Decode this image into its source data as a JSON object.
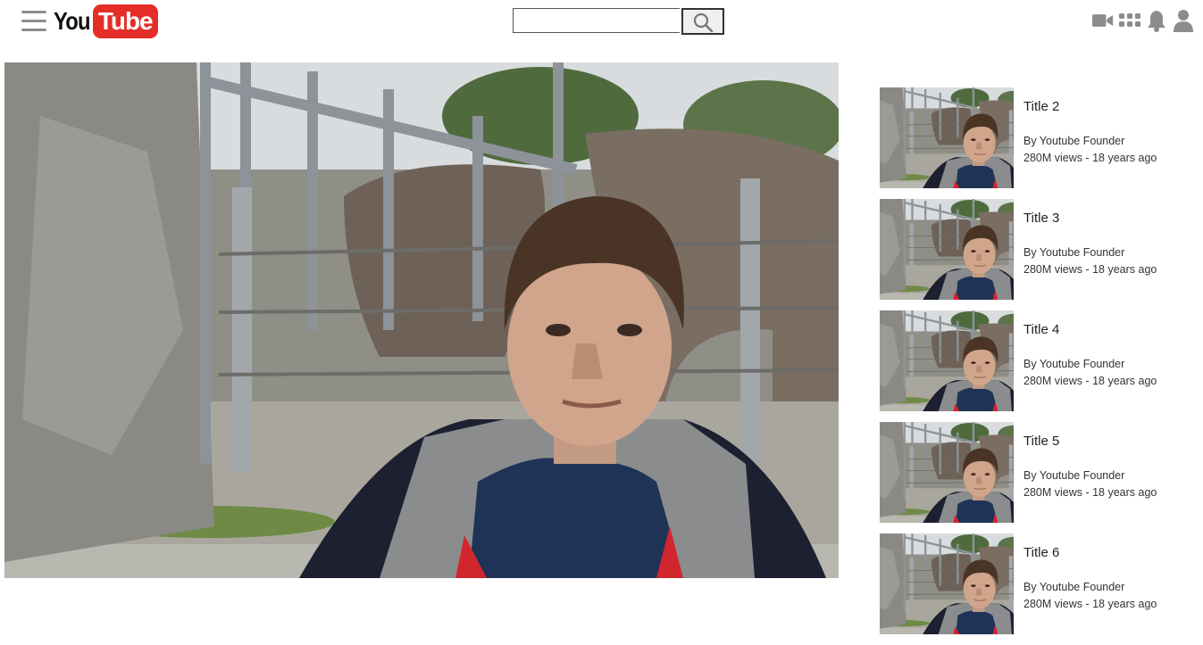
{
  "header": {
    "logo_you": "You",
    "logo_tube": "Tube",
    "search": {
      "value": "",
      "placeholder": ""
    },
    "icons": [
      "menu-icon",
      "search-icon",
      "video-camera-icon",
      "apps-grid-icon",
      "bell-icon",
      "user-icon"
    ]
  },
  "colors": {
    "brand_red": "#e52d27",
    "icon_gray": "#8c8c8c"
  },
  "recommendations": [
    {
      "title": "Title 2",
      "channel": "By Youtube Founder",
      "meta": "280M views - 18 years ago"
    },
    {
      "title": "Title 3",
      "channel": "By Youtube Founder",
      "meta": "280M views - 18 years ago"
    },
    {
      "title": "Title 4",
      "channel": "By Youtube Founder",
      "meta": "280M views - 18 years ago"
    },
    {
      "title": "Title 5",
      "channel": "By Youtube Founder",
      "meta": "280M views - 18 years ago"
    },
    {
      "title": "Title 6",
      "channel": "By Youtube Founder",
      "meta": "280M views - 18 years ago"
    }
  ]
}
